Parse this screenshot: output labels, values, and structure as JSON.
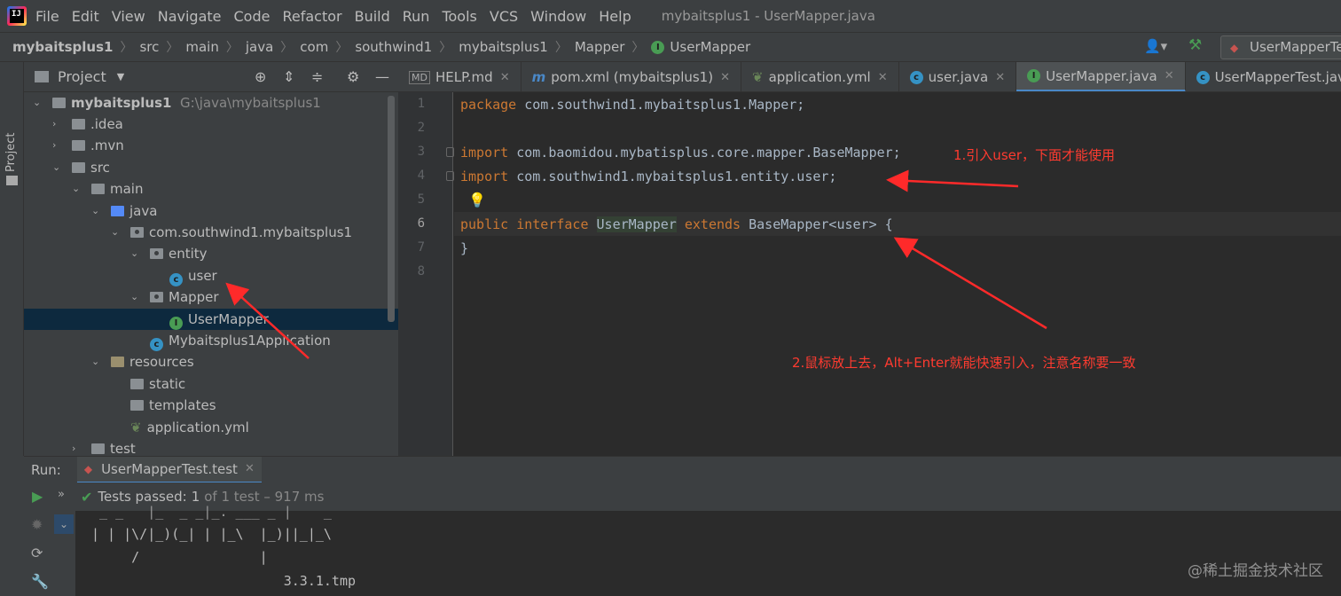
{
  "menubar": {
    "items": [
      "File",
      "Edit",
      "View",
      "Navigate",
      "Code",
      "Refactor",
      "Build",
      "Run",
      "Tools",
      "VCS",
      "Window",
      "Help"
    ],
    "window_title": "mybaitsplus1 - UserMapper.java"
  },
  "breadcrumb": [
    "mybaitsplus1",
    "src",
    "main",
    "java",
    "com",
    "southwind1",
    "mybaitsplus1",
    "Mapper",
    "UserMapper"
  ],
  "run_config": "UserMapperTe",
  "project_panel": {
    "title": "Project",
    "side_label": "Project",
    "tree": [
      {
        "label": "mybaitsplus1",
        "path": "G:\\java\\mybaitsplus1"
      },
      {
        "label": ".idea"
      },
      {
        "label": ".mvn"
      },
      {
        "label": "src"
      },
      {
        "label": "main"
      },
      {
        "label": "java"
      },
      {
        "label": "com.southwind1.mybaitsplus1"
      },
      {
        "label": "entity"
      },
      {
        "label": "user"
      },
      {
        "label": "Mapper"
      },
      {
        "label": "UserMapper"
      },
      {
        "label": "Mybaitsplus1Application"
      },
      {
        "label": "resources"
      },
      {
        "label": "static"
      },
      {
        "label": "templates"
      },
      {
        "label": "application.yml"
      },
      {
        "label": "test"
      }
    ]
  },
  "tabs": [
    {
      "label": "HELP.md",
      "icon": "markdown-icon"
    },
    {
      "label": "pom.xml (mybaitsplus1)",
      "icon": "maven-icon"
    },
    {
      "label": "application.yml",
      "icon": "spring-yml-icon"
    },
    {
      "label": "user.java",
      "icon": "class-icon"
    },
    {
      "label": "UserMapper.java",
      "icon": "interface-icon",
      "active": true
    },
    {
      "label": "UserMapperTest.java",
      "icon": "test-class-icon"
    }
  ],
  "editor": {
    "line_numbers": [
      "1",
      "2",
      "3",
      "4",
      "5",
      "6",
      "7",
      "8"
    ],
    "lines": {
      "l1_kw": "package",
      "l1_rest": " com.southwind1.mybaitsplus1.Mapper;",
      "l3_kw": "import",
      "l3_rest": " com.baomidou.mybatisplus.core.mapper.BaseMapper;",
      "l4_kw": "import",
      "l4_rest": " com.southwind1.mybaitsplus1.entity.user;",
      "l6_kw1": "public",
      "l6_kw2": "interface",
      "l6_name": "UserMapper",
      "l6_kw3": "extends",
      "l6_rest": " BaseMapper<user> {",
      "l7": "}"
    },
    "annotation1": "1.引入user，下面才能使用",
    "annotation2": "2.鼠标放上去，Alt+Enter就能快速引入，注意名称要一致"
  },
  "run_panel": {
    "label": "Run:",
    "tab": "UserMapperTest.test",
    "status": "Tests passed:",
    "count": "1",
    "detail": "of 1 test – 917 ms",
    "console": [
      " _ _   |_  _ _|_. ___ _ |    _ ",
      "| | |\\/|_)(_| | |_\\  |_)||_|_\\ ",
      "     /               |",
      "                        3.3.1.tmp"
    ]
  },
  "watermark": "@稀土掘金技术社区",
  "colors": {
    "accent": "#4a88c7",
    "annotation": "#ff3b30",
    "keyword": "#cc7832",
    "pass": "#499c54"
  }
}
